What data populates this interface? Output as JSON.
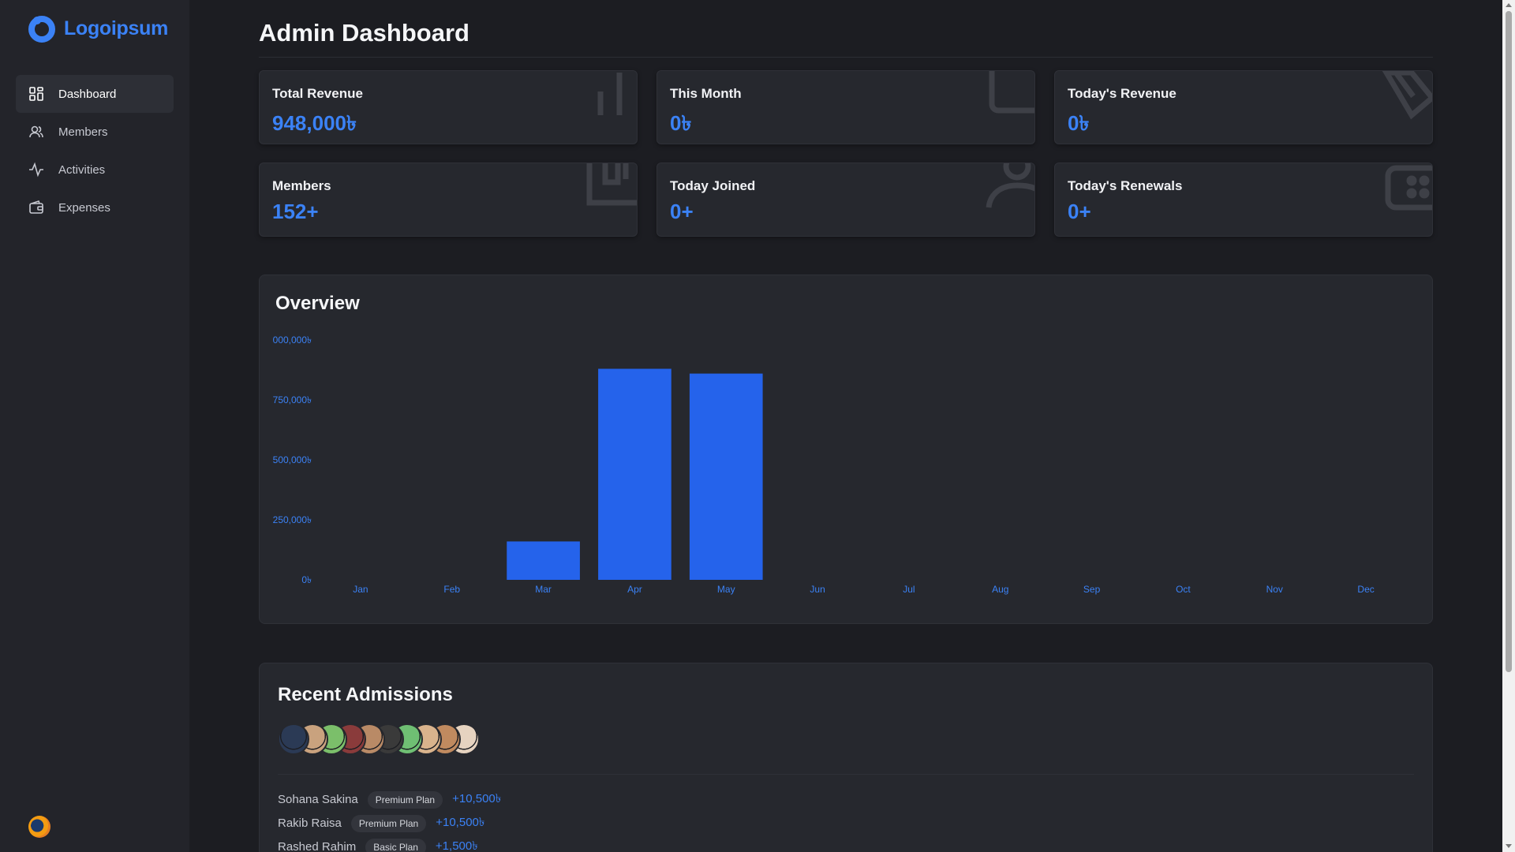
{
  "brand": {
    "name": "Logoipsum",
    "accent": "#3b82f6"
  },
  "sidebar": {
    "items": [
      {
        "label": "Dashboard",
        "icon": "grid-icon",
        "active": true
      },
      {
        "label": "Members",
        "icon": "users-icon",
        "active": false
      },
      {
        "label": "Activities",
        "icon": "activity-icon",
        "active": false
      },
      {
        "label": "Expenses",
        "icon": "wallet-icon",
        "active": false
      }
    ]
  },
  "page": {
    "title": "Admin Dashboard"
  },
  "stats": [
    {
      "label": "Total Revenue",
      "value": "948,000৳",
      "icon": "bar-chart-icon"
    },
    {
      "label": "This Month",
      "value": "0৳",
      "icon": "calendar-icon"
    },
    {
      "label": "Today's Revenue",
      "value": "0৳",
      "icon": "tag-icon"
    },
    {
      "label": "Members",
      "value": "152+",
      "icon": "id-card-icon"
    },
    {
      "label": "Today Joined",
      "value": "0+",
      "icon": "user-icon"
    },
    {
      "label": "Today's Renewals",
      "value": "0+",
      "icon": "refresh-icon"
    }
  ],
  "overview": {
    "title": "Overview"
  },
  "chart_data": {
    "type": "bar",
    "title": "Overview",
    "categories": [
      "Jan",
      "Feb",
      "Mar",
      "Apr",
      "May",
      "Jun",
      "Jul",
      "Aug",
      "Sep",
      "Oct",
      "Nov",
      "Dec"
    ],
    "values": [
      0,
      0,
      160000,
      880000,
      860000,
      0,
      0,
      0,
      0,
      0,
      0,
      0
    ],
    "ylim": [
      0,
      1000000
    ],
    "yticks": [
      0,
      250000,
      500000,
      750000,
      1000000
    ],
    "ytick_labels": [
      "0৳",
      "250,000৳",
      "500,000৳",
      "750,000৳",
      "000,000৳"
    ],
    "bar_color": "#2563eb",
    "grid": false
  },
  "recent": {
    "title": "Recent Admissions",
    "avatar_colors": [
      "#2b3a55",
      "#c9a27e",
      "#7bbf6a",
      "#8a3b3b",
      "#b98a66",
      "#3a3a3a",
      "#6fbf73",
      "#d9b38c",
      "#c08a5f",
      "#e6d3c0"
    ],
    "rows": [
      {
        "name": "Sohana Sakina",
        "plan": "Premium Plan",
        "amount": "+10,500৳"
      },
      {
        "name": "Rakib Raisa",
        "plan": "Premium Plan",
        "amount": "+10,500৳"
      },
      {
        "name": "Rashed Rahim",
        "plan": "Basic Plan",
        "amount": "+1,500৳"
      }
    ]
  }
}
